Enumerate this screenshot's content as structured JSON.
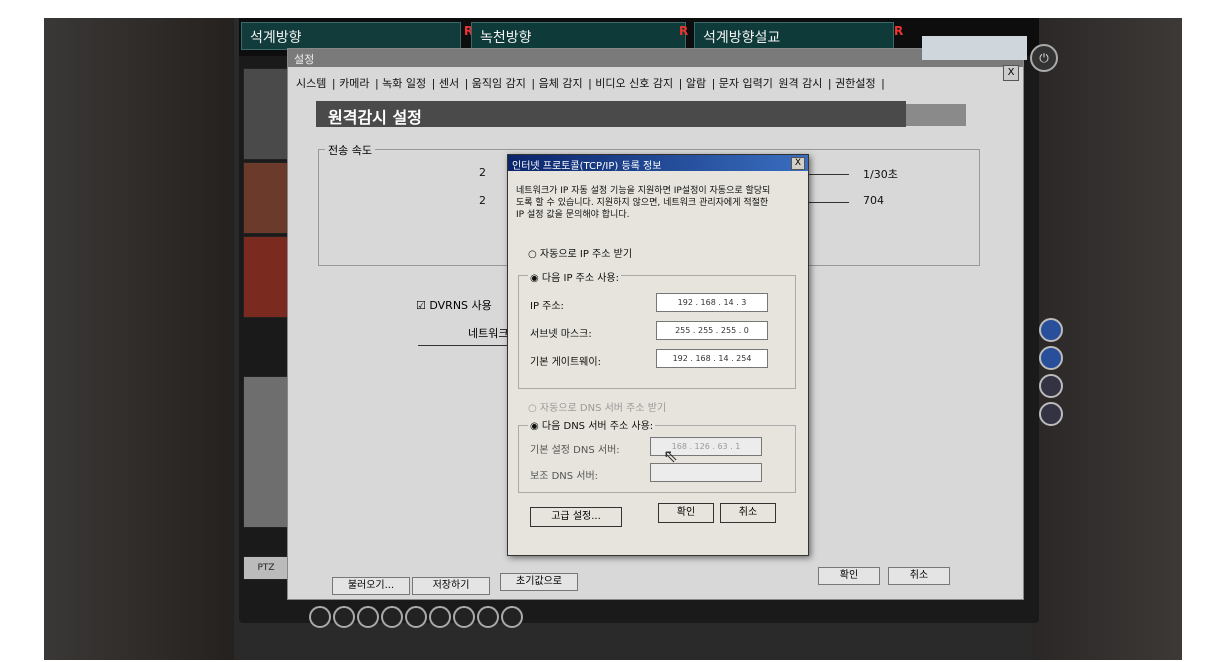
{
  "camera_bar": {
    "cam1": "석계방향",
    "cam2": "녹천방향",
    "cam3": "석계방향설교",
    "rec_flag": "R"
  },
  "settings_window": {
    "title": "설정",
    "close": "X",
    "tabs": [
      "시스템",
      "카메라",
      "녹화 일정",
      "센서",
      "움직임 감지",
      "음체 감지",
      "비디오 신호 감지",
      "알람",
      "문자 입력기",
      "원격 감시",
      "권한설정"
    ],
    "section_title": "원격감시 설정",
    "transfer_group_label": "전송 속도",
    "rate_value": "1/30초",
    "size_value": "704",
    "row_digit_1": "2",
    "row_digit_2": "2",
    "dvrns_checkbox": "DVRNS 사용",
    "network_label": "네트워크",
    "bottom_buttons": {
      "load": "불러오기...",
      "save": "저장하기",
      "default": "초기값으로",
      "ok": "확인",
      "cancel": "취소"
    }
  },
  "dialog": {
    "title": "인터넷 프로토콜(TCP/IP) 등록 정보",
    "close": "X",
    "info_line1": "네트워크가 IP 자동 설정 기능을 지원하면 IP설정이 자동으로 할당되",
    "info_line2": "도록 할 수 있습니다. 지원하지 않으면, 네트워크 관리자에게 적절한",
    "info_line3": "IP 설정 값을 문의해야 합니다.",
    "radio_auto_ip": "자동으로 IP 주소 받기",
    "radio_manual_ip": "다음 IP 주소 사용:",
    "ip_label": "IP 주소:",
    "ip_value": "192 . 168 . 14 . 3",
    "subnet_label": "서브넷 마스크:",
    "subnet_value": "255 . 255 . 255 . 0",
    "gateway_label": "기본 게이트웨이:",
    "gateway_value": "192 . 168 . 14 . 254",
    "radio_auto_dns": "자동으로 DNS 서버 주소 받기",
    "radio_manual_dns": "다음 DNS 서버 주소 사용:",
    "dns1_label": "기본 설정 DNS 서버:",
    "dns1_value": "168 . 126 . 63 . 1",
    "dns2_label": "보조 DNS 서버:",
    "dns2_value": "",
    "advanced_button": "고급 설정...",
    "ok_button": "확인",
    "cancel_button": "취소"
  },
  "side": {
    "ptz_label": "PTZ"
  }
}
